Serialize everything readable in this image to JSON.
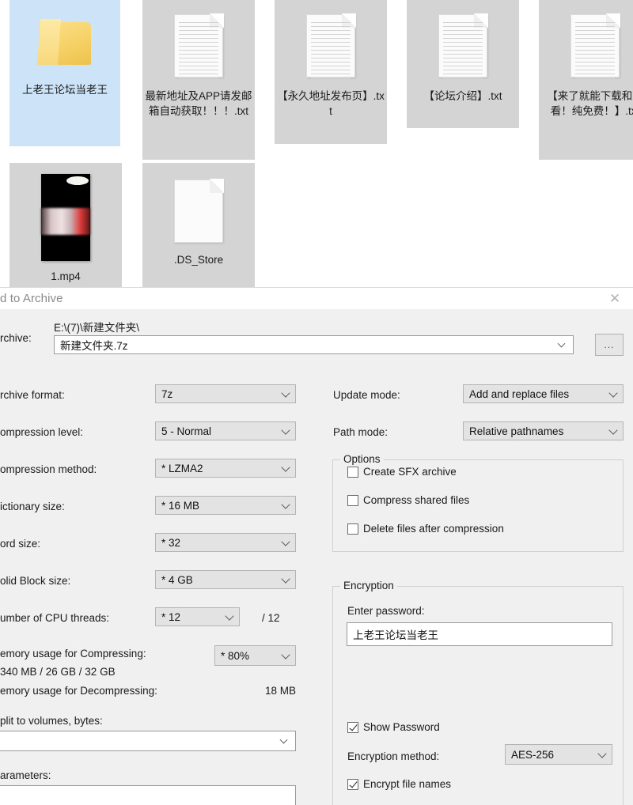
{
  "explorer": {
    "items": [
      {
        "name": "上老王论坛当老王",
        "type": "folder",
        "selected": true
      },
      {
        "name": "最新地址及APP请发邮箱自动获取！！！.txt",
        "type": "txt",
        "selected": false
      },
      {
        "name": "【永久地址发布页】.txt",
        "type": "txt",
        "selected": false
      },
      {
        "name": "【论坛介绍】.txt",
        "type": "txt",
        "selected": false
      },
      {
        "name": "【来了就能下载和观看！纯免费！】.txt",
        "type": "txt",
        "selected": false
      },
      {
        "name": "1.mp4",
        "type": "video",
        "selected": false
      },
      {
        "name": ".DS_Store",
        "type": "blank",
        "selected": false
      }
    ]
  },
  "dialog": {
    "title": "d to Archive",
    "close_icon": "close-icon",
    "archive": {
      "label": "rchive:",
      "path": "E:\\(7)\\新建文件夹\\",
      "filename": "新建文件夹.7z",
      "browse_label": "..."
    },
    "left": {
      "archive_format_label": "rchive format:",
      "archive_format_value": "7z",
      "compression_level_label": "ompression level:",
      "compression_level_value": "5 - Normal",
      "compression_method_label": "ompression method:",
      "compression_method_value": "*  LZMA2",
      "dictionary_size_label": "ictionary size:",
      "dictionary_size_value": "*  16 MB",
      "word_size_label": "ord size:",
      "word_size_value": "*  32",
      "solid_block_size_label": "olid Block size:",
      "solid_block_size_value": "*  4 GB",
      "cpu_threads_label": "umber of CPU threads:",
      "cpu_threads_value": "*  12",
      "cpu_threads_total": "/ 12",
      "mem_compress_label": "emory usage for Compressing:",
      "mem_compress_value": "340 MB / 26 GB / 32 GB",
      "mem_compress_percent": "*  80%",
      "mem_decompress_label": "emory usage for Decompressing:",
      "mem_decompress_value": "18 MB",
      "split_label": "plit to volumes, bytes:",
      "split_value": "",
      "parameters_label": "arameters:",
      "parameters_value": ""
    },
    "right": {
      "update_mode_label": "Update mode:",
      "update_mode_value": "Add and replace files",
      "path_mode_label": "Path mode:",
      "path_mode_value": "Relative pathnames",
      "options_legend": "Options",
      "options": [
        {
          "label": "Create SFX archive",
          "checked": false
        },
        {
          "label": "Compress shared files",
          "checked": false
        },
        {
          "label": "Delete files after compression",
          "checked": false
        }
      ],
      "encryption_legend": "Encryption",
      "enter_password_label": "Enter password:",
      "password_value": "上老王论坛当老王",
      "show_password_label": "Show Password",
      "show_password_checked": true,
      "encryption_method_label": "Encryption method:",
      "encryption_method_value": "AES-256",
      "encrypt_file_names_label": "Encrypt file names",
      "encrypt_file_names_checked": true
    }
  },
  "colors": {
    "selection": "#cde3f7",
    "tile": "#d4d4d4",
    "dialog_bg": "#f0f0f0",
    "combo_bg": "#e3e3e3",
    "accent_text": "#1a1a1a"
  }
}
